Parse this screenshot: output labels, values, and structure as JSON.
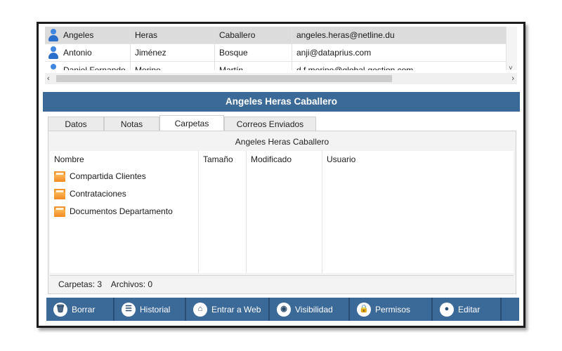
{
  "contacts": {
    "rows": [
      {
        "nombre": "Angeles",
        "apellido1": "Heras",
        "apellido2": "Caballero",
        "email": "angeles.heras@netline.du",
        "selected": true
      },
      {
        "nombre": "Antonio",
        "apellido1": "Jiménez",
        "apellido2": "Bosque",
        "email": "anji@dataprius.com",
        "selected": false
      },
      {
        "nombre": "Daniel Fernando",
        "apellido1": "Merino",
        "apellido2": "Martín",
        "email": "d.f.merino@global-gestion.com",
        "selected": false
      }
    ],
    "row_icon": "person-icon",
    "scroll_left": "‹",
    "scroll_right": "›",
    "scroll_down": "˅"
  },
  "detail": {
    "title": "Angeles Heras Caballero"
  },
  "tabs": [
    {
      "label": "Datos",
      "active": false
    },
    {
      "label": "Notas",
      "active": false
    },
    {
      "label": "Carpetas",
      "active": true
    },
    {
      "label": "Correos Enviados",
      "active": false
    }
  ],
  "panel": {
    "title": "Angeles Heras Caballero",
    "columns": [
      "Nombre",
      "Tamaño",
      "Modificado",
      "Usuario"
    ],
    "folders": [
      {
        "name": "Compartida Clientes",
        "icon": "folder-icon"
      },
      {
        "name": "Contrataciones",
        "icon": "folder-icon"
      },
      {
        "name": "Documentos Departamento",
        "icon": "folder-icon"
      }
    ],
    "status": {
      "carpetas": "Carpetas: 3",
      "archivos": "Archivos: 0"
    }
  },
  "toolbar": {
    "buttons": [
      {
        "label": "Borrar",
        "icon": "trash-icon",
        "glyph": "🗑"
      },
      {
        "label": "Historial",
        "icon": "list-icon",
        "glyph": "☰"
      },
      {
        "label": "Entrar a Web",
        "icon": "home-icon",
        "glyph": "⌂"
      },
      {
        "label": "Visibilidad",
        "icon": "visibility-icon",
        "glyph": "◉"
      },
      {
        "label": "Permisos",
        "icon": "lock-icon",
        "glyph": "🔒"
      },
      {
        "label": "Editar",
        "icon": "user-icon",
        "glyph": "●"
      }
    ]
  },
  "colors": {
    "header_bg": "#3c6a98",
    "toolbar_bg": "#3c6a98",
    "folder": "#f0942c",
    "person_icon": "#2a6fcb"
  }
}
